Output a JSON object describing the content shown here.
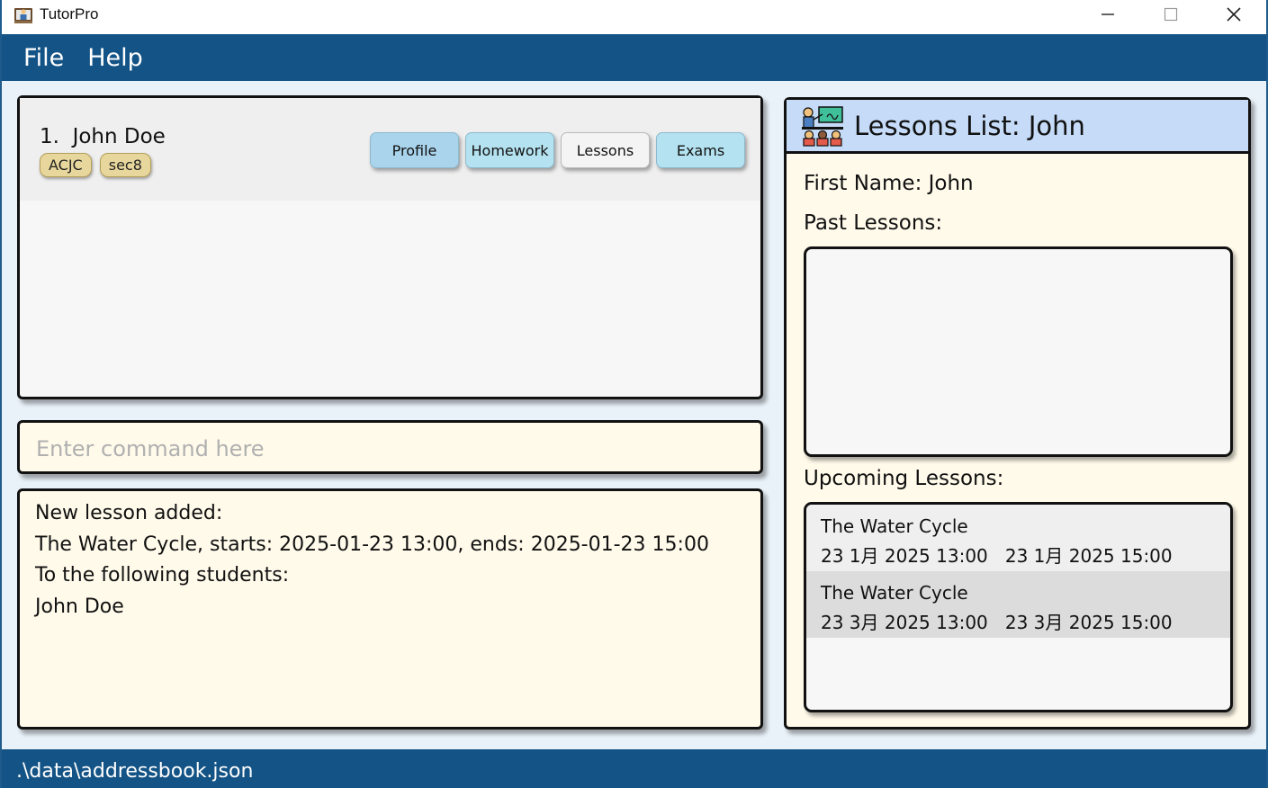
{
  "window": {
    "title": "TutorPro",
    "icon": "tutor-app-icon",
    "controls": [
      "minimize-icon",
      "maximize-icon",
      "close-icon"
    ]
  },
  "menu": {
    "items": [
      {
        "label": "File"
      },
      {
        "label": "Help"
      }
    ]
  },
  "person_list": {
    "persons": [
      {
        "index": "1.",
        "name": "John Doe",
        "display": "1.  John Doe",
        "tags": [
          "ACJC",
          "sec8"
        ]
      }
    ],
    "tabs": [
      {
        "label": "Profile",
        "color": "#a9d4ec"
      },
      {
        "label": "Homework",
        "color": "#b4e2f0"
      },
      {
        "label": "Lessons",
        "color": "#f4f4f4"
      },
      {
        "label": "Exams",
        "color": "#b4e2f0"
      }
    ]
  },
  "command": {
    "placeholder": "Enter command here",
    "value": ""
  },
  "result": {
    "lines": [
      "New lesson added:",
      "The Water Cycle, starts: 2025-01-23 13:00, ends: 2025-01-23 15:00",
      "To the following students:",
      "John Doe"
    ]
  },
  "lessons_panel": {
    "title": "Lessons List: John",
    "first_name": "First Name: John",
    "past_label": "Past Lessons:",
    "past_lessons": [],
    "upcoming_label": "Upcoming Lessons:",
    "upcoming_lessons": [
      {
        "title": "The Water Cycle",
        "time": "23 1月 2025 13:00   23 1月 2025 15:00"
      },
      {
        "title": "The Water Cycle",
        "time": "23 3月 2025 13:00   23 3月 2025 15:00"
      }
    ]
  },
  "status": {
    "file_path": ".\\data\\addressbook.json"
  },
  "colors": {
    "primary": "#145385",
    "panel_bg": "#fffaea",
    "header_bg": "#c5dbf7",
    "tag_bg": "#e8d79d"
  }
}
